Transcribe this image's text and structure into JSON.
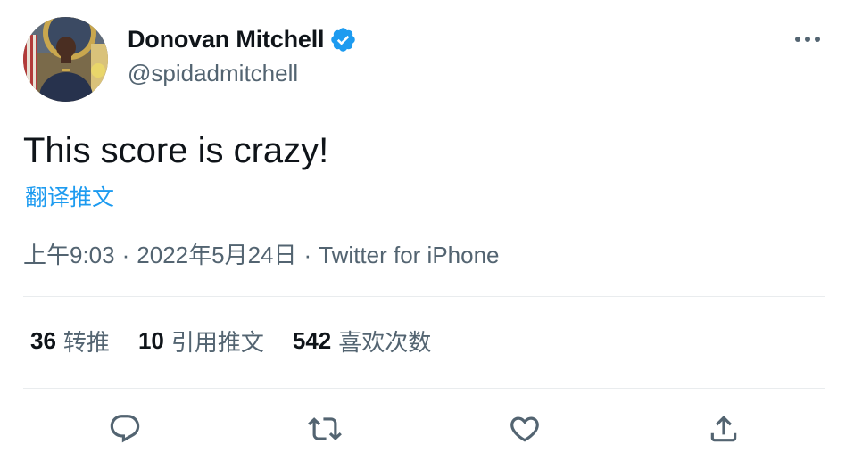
{
  "user": {
    "display_name": "Donovan Mitchell",
    "handle": "@spidadmitchell",
    "verified_icon": "verified-badge-icon"
  },
  "tweet": {
    "text": "This score is crazy!",
    "translate_label": "翻译推文"
  },
  "meta": {
    "time": "上午9:03",
    "separator": "·",
    "date": "2022年5月24日",
    "source": "Twitter for iPhone"
  },
  "stats": {
    "retweets_count": "36",
    "retweets_label": "转推",
    "quotes_count": "10",
    "quotes_label": "引用推文",
    "likes_count": "542",
    "likes_label": "喜欢次数"
  },
  "actions": {
    "reply_icon": "reply-icon",
    "retweet_icon": "retweet-icon",
    "like_icon": "heart-icon",
    "share_icon": "share-icon"
  },
  "colors": {
    "accent": "#1d9bf0",
    "text": "#0f1419",
    "secondary": "#536471",
    "divider": "#e9ecee"
  }
}
